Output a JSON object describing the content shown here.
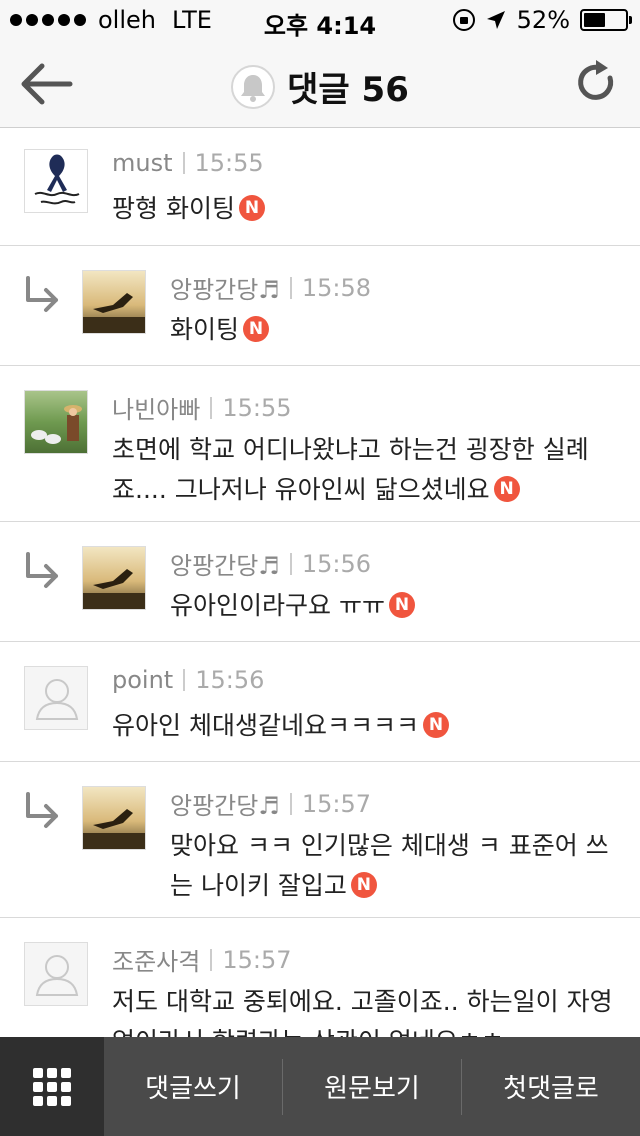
{
  "status_bar": {
    "carrier": "olleh",
    "network": "LTE",
    "time": "오후 4:14",
    "battery": "52%",
    "battery_level": 0.52,
    "icons": [
      "signal-dots-icon",
      "orientation-lock-icon",
      "location-arrow-icon",
      "battery-icon"
    ]
  },
  "nav": {
    "title": "댓글 56",
    "icons": [
      "back-arrow-icon",
      "bell-icon",
      "refresh-icon"
    ]
  },
  "comments": [
    {
      "author": "must",
      "time": "15:55",
      "text": "팡형 화이팅",
      "is_reply": false,
      "new": "N"
    },
    {
      "author": "앙팡간당♬",
      "time": "15:58",
      "text": "화이팅",
      "is_reply": true,
      "new": "N"
    },
    {
      "author": "나빈아빠",
      "time": "15:55",
      "text": "초면에 학교 어디나왔냐고 하는건 굉장한 실례죠.... 그나저나 유아인씨 닮으셨네요",
      "is_reply": false,
      "new": "N"
    },
    {
      "author": "앙팡간당♬",
      "time": "15:56",
      "text": "유아인이라구요 ㅠㅠ",
      "is_reply": true,
      "new": "N"
    },
    {
      "author": "point",
      "time": "15:56",
      "text": "유아인 체대생같네요ㅋㅋㅋㅋ",
      "is_reply": false,
      "new": "N"
    },
    {
      "author": "앙팡간당♬",
      "time": "15:57",
      "text": "맞아요 ㅋㅋ 인기많은 체대생 ㅋ 표준어 쓰는 나이키 잘입고",
      "is_reply": true,
      "new": "N"
    },
    {
      "author": "조준사격",
      "time": "15:57",
      "text": "저도 대학교 중퇴에요. 고졸이죠.. 하는일이 자영업이라서 학력과는 상관이 없네요ㅎㅎ",
      "is_reply": false,
      "new": ""
    }
  ],
  "toolbar": {
    "menu_icon": "grid-menu-icon",
    "write_label": "댓글쓰기",
    "original_label": "원문보기",
    "first_label": "첫댓글로"
  },
  "colors": {
    "new_badge": "#f0553e",
    "toolbar_bg": "#4a4a4a",
    "nav_bg": "#f7f7f7"
  }
}
